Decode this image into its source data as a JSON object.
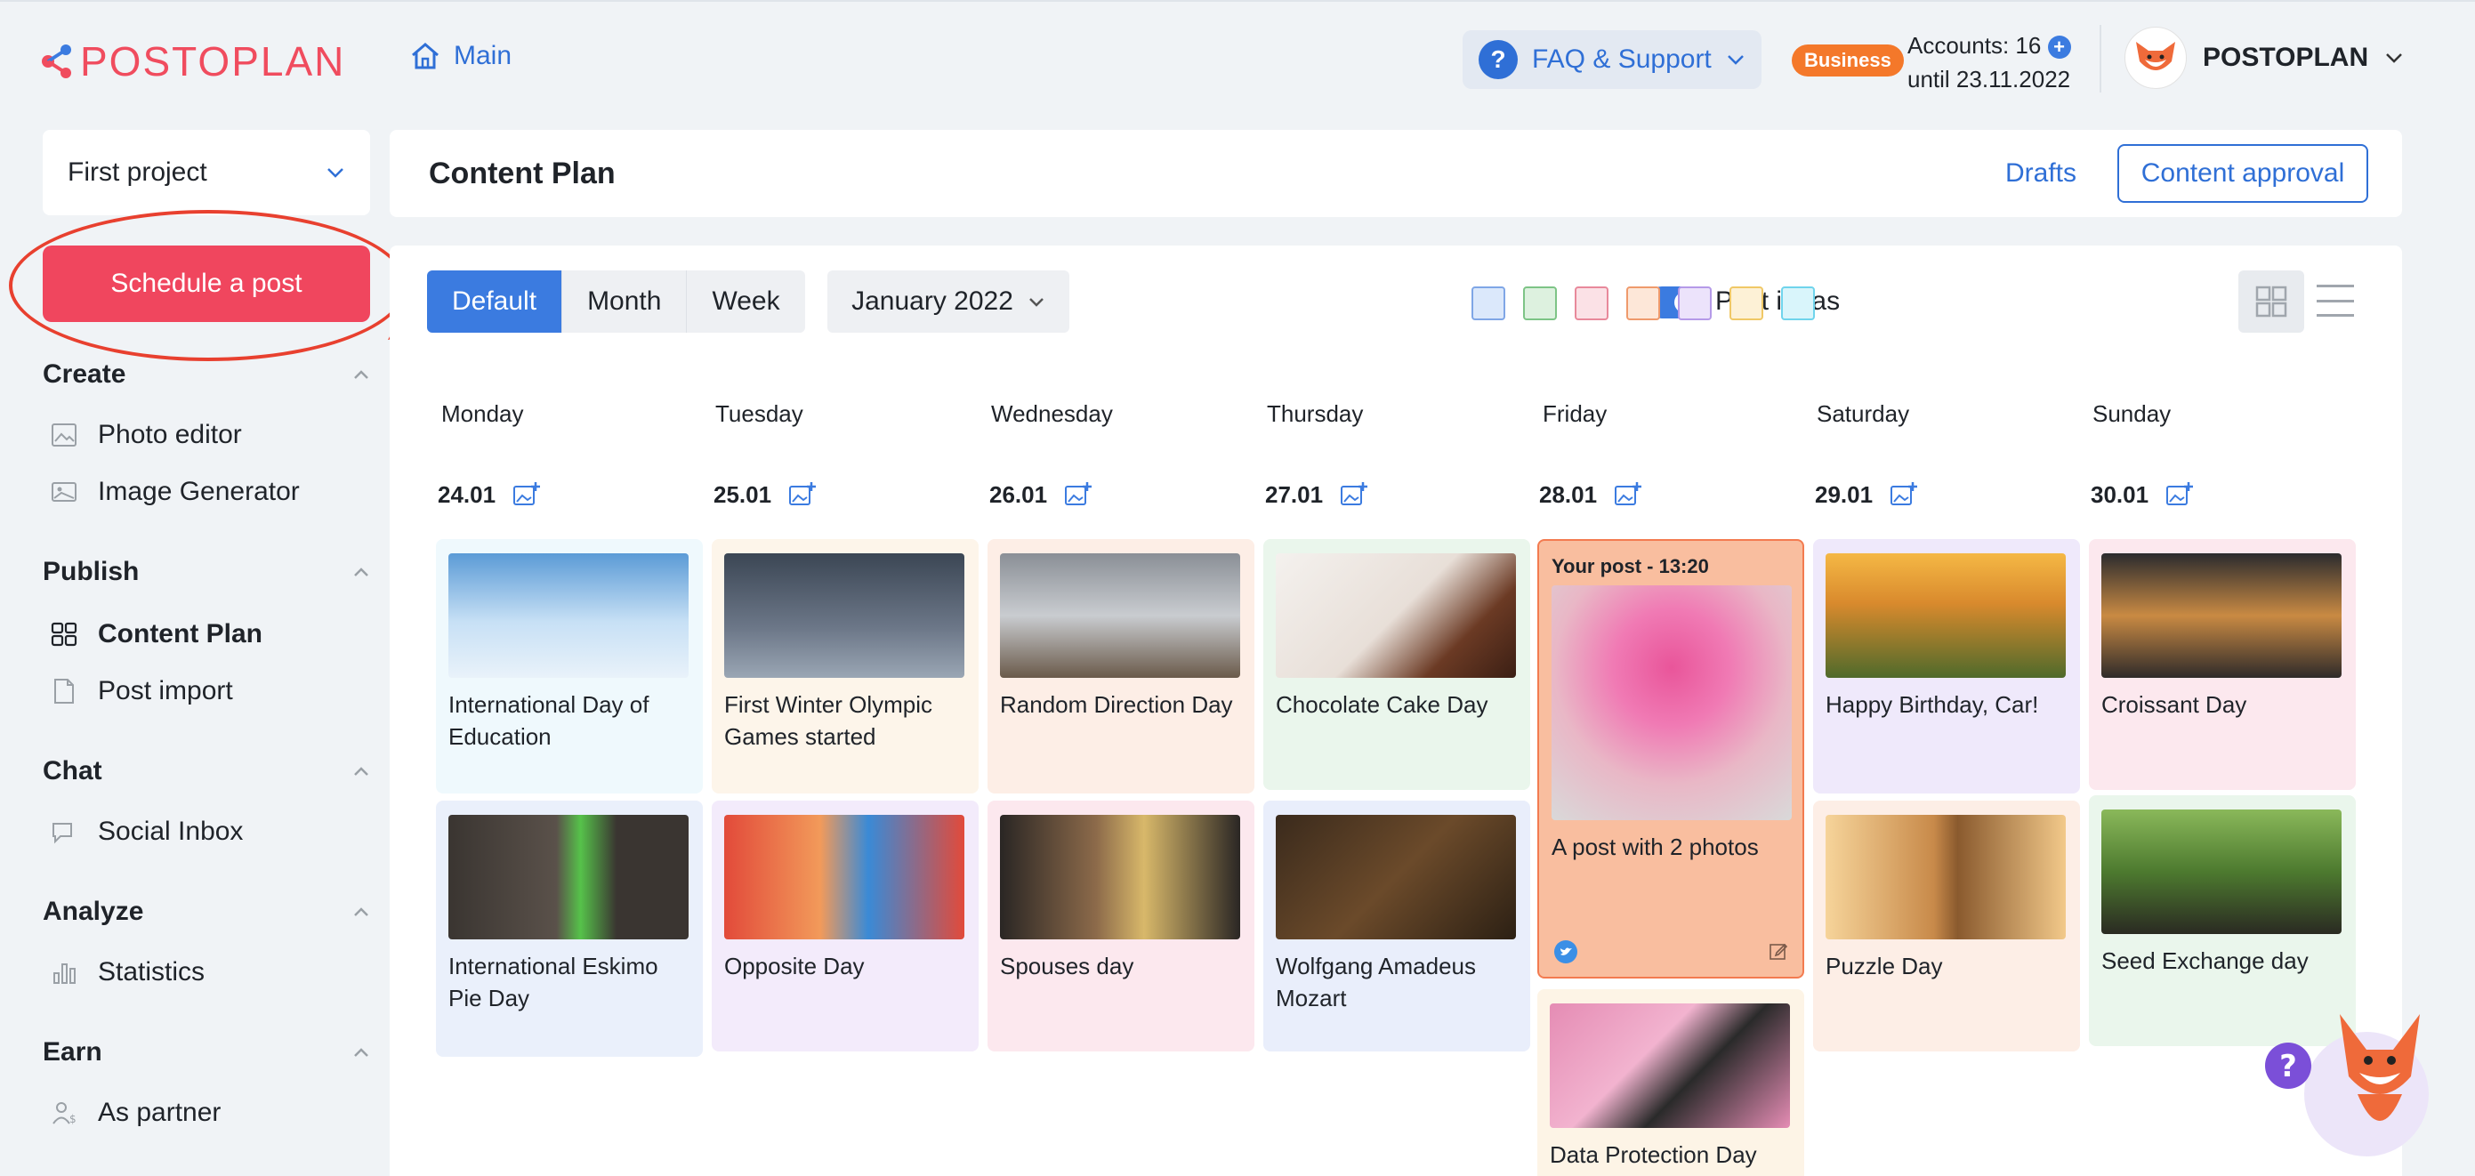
{
  "topbar": {
    "logo": "POSTOPLAN",
    "main_link": "Main",
    "faq_label": "FAQ & Support",
    "plan_badge": "Business",
    "accounts_label": "Accounts: 16",
    "accounts_until": "until 23.11.2022",
    "user_name": "POSTOPLAN"
  },
  "sidebar": {
    "project": "First project",
    "schedule_button": "Schedule a post",
    "sections": [
      {
        "title": "Create",
        "items": [
          "Photo editor",
          "Image Generator"
        ]
      },
      {
        "title": "Publish",
        "items": [
          "Content Plan",
          "Post import"
        ]
      },
      {
        "title": "Chat",
        "items": [
          "Social Inbox"
        ]
      },
      {
        "title": "Analyze",
        "items": [
          "Statistics"
        ]
      },
      {
        "title": "Earn",
        "items": [
          "As partner"
        ]
      }
    ]
  },
  "header": {
    "title": "Content Plan",
    "drafts": "Drafts",
    "approval": "Content approval"
  },
  "toolbar": {
    "tabs": [
      "Default",
      "Month",
      "Week"
    ],
    "month": "January 2022",
    "post_ideas": "Post ideas",
    "colors": [
      "#dbe8fb",
      "#ddf1df",
      "#fbe1e6",
      "#fde7d8",
      "#ece3fb",
      "#fdf1d6",
      "#d9f5fb"
    ],
    "color_borders": [
      "#7fa6e6",
      "#7dc486",
      "#e8899b",
      "#ef9a6c",
      "#b59ae8",
      "#f0c866",
      "#6fd4ec"
    ]
  },
  "calendar": {
    "days": [
      "Monday",
      "Tuesday",
      "Wednesday",
      "Thursday",
      "Friday",
      "Saturday",
      "Sunday"
    ],
    "dates": [
      "24.01",
      "25.01",
      "26.01",
      "27.01",
      "28.01",
      "29.01",
      "30.01"
    ],
    "cards": [
      [
        "International Day of Education",
        "International Eskimo Pie Day"
      ],
      [
        "First Winter Olympic Games started",
        "Opposite Day"
      ],
      [
        "Random Direction Day",
        "Spouses day"
      ],
      [
        "Chocolate Cake Day",
        "Wolfgang Amadeus Mozart"
      ],
      [
        "A post with 2 photos",
        "Data Protection Day"
      ],
      [
        "Happy Birthday, Car!",
        "Puzzle Day"
      ],
      [
        "Croissant Day",
        "Seed Exchange day"
      ]
    ],
    "my_post_header": "Your post - 13:20"
  }
}
